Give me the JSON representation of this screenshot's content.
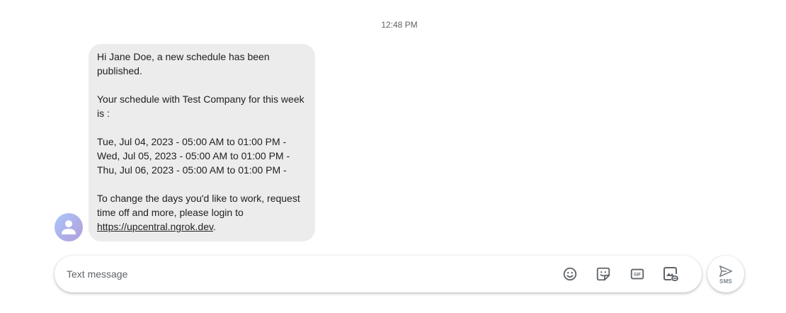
{
  "conversation": {
    "timestamp": "12:48 PM",
    "message": {
      "greeting": "Hi Jane Doe, a new schedule has been published.",
      "intro": "Your schedule with Test Company for this week is :",
      "shifts": [
        "Tue, Jul 04, 2023 - 05:00 AM to 01:00 PM -",
        "Wed, Jul 05, 2023 - 05:00 AM to 01:00 PM -",
        "Thu, Jul 06, 2023 - 05:00 AM to 01:00 PM -"
      ],
      "closing": "To change the days you'd like to work, request time off and more, please login to",
      "link": "https://upcentral.ngrok.dev",
      "link_suffix": "."
    }
  },
  "composer": {
    "placeholder": "Text message",
    "value": "",
    "tools": [
      "emoji-icon",
      "sticker-icon",
      "gif-icon",
      "attach-media-icon"
    ],
    "send_label": "SMS",
    "send_icon": "send-icon"
  },
  "colors": {
    "bubble": "#ececec",
    "icon": "#5f6368",
    "send_disabled": "#80868b"
  }
}
